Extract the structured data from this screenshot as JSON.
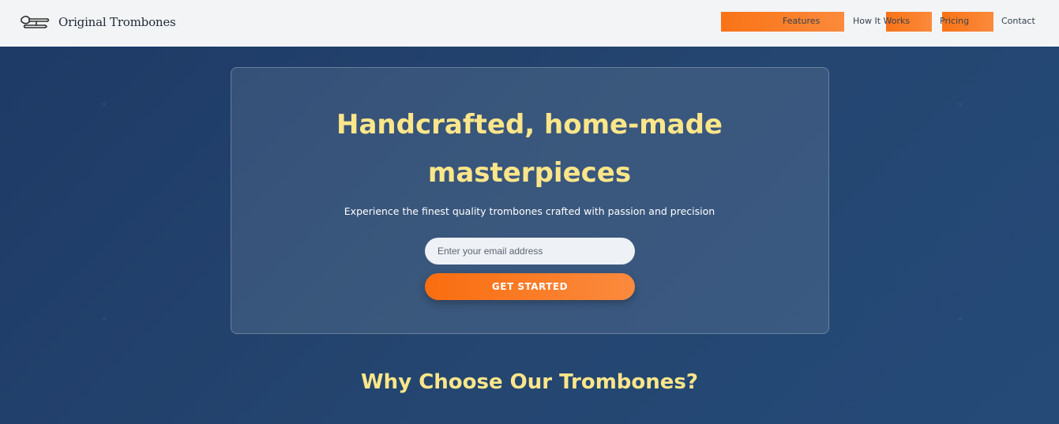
{
  "brand": {
    "name": "Original Trombones",
    "icon": "trombone-icon"
  },
  "nav": {
    "items": [
      {
        "label": "Features",
        "highlighted": true
      },
      {
        "label": "How It Works",
        "highlighted": true
      },
      {
        "label": "Pricing",
        "highlighted": true
      },
      {
        "label": "Contact",
        "highlighted": false
      }
    ]
  },
  "hero": {
    "title_line1": "Handcrafted, home-made",
    "title_line2": "masterpieces",
    "subtitle": "Experience the finest quality trombones crafted with passion and precision",
    "email_placeholder": "Enter your email address",
    "email_value": "",
    "cta_label": "GET STARTED"
  },
  "section": {
    "title": "Why Choose Our Trombones?"
  },
  "colors": {
    "accent": "#f97316",
    "title": "#fde68a",
    "background": "#22406b",
    "navbar": "#f3f4f6"
  }
}
